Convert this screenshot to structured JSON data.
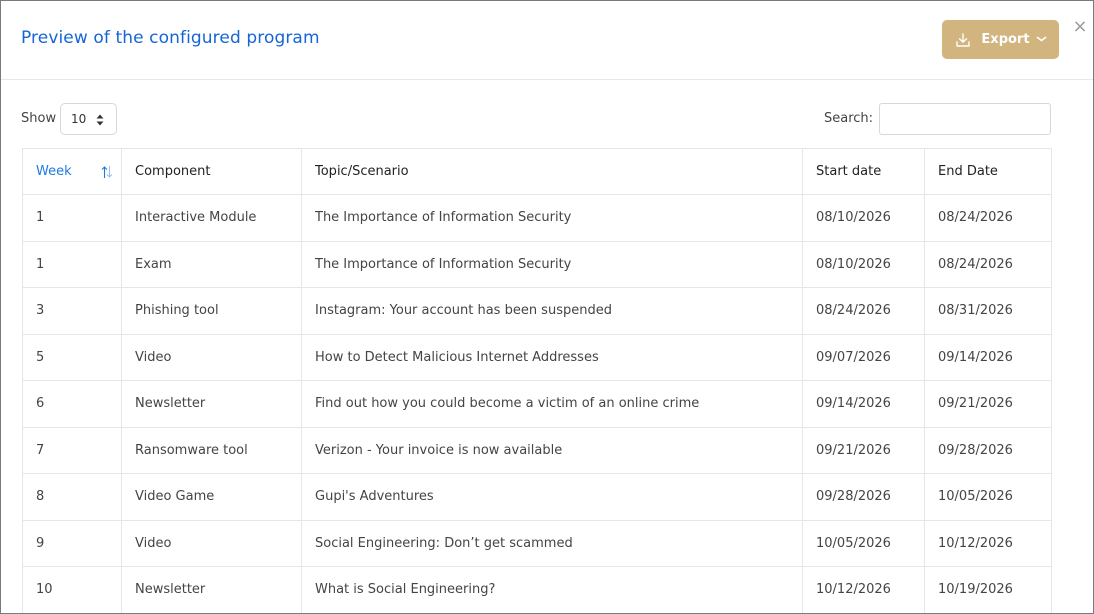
{
  "modal": {
    "title": "Preview of the configured program",
    "export_label": "Export",
    "close_symbol": "×"
  },
  "controls": {
    "show_label": "Show",
    "show_value": "10",
    "search_label": "Search:",
    "search_value": "",
    "search_placeholder": ""
  },
  "icons": {
    "export": "download-icon",
    "export_menu": "chevron-down-icon",
    "close": "close-icon",
    "sort": "sort-arrows-icon",
    "select": "select-arrows-icon"
  },
  "colors": {
    "title": "#1565d8",
    "export_button": "#d2b47f",
    "sorted_header": "#1e7be0"
  },
  "table": {
    "columns": [
      "Week",
      "Component",
      "Topic/Scenario",
      "Start date",
      "End Date"
    ],
    "rows": [
      [
        "1",
        "Interactive Module",
        "The Importance of Information Security",
        "08/10/2026",
        "08/24/2026"
      ],
      [
        "1",
        "Exam",
        "The Importance of Information Security",
        "08/10/2026",
        "08/24/2026"
      ],
      [
        "3",
        "Phishing tool",
        "Instagram: Your account has been suspended",
        "08/24/2026",
        "08/31/2026"
      ],
      [
        "5",
        "Video",
        "How to Detect Malicious Internet Addresses",
        "09/07/2026",
        "09/14/2026"
      ],
      [
        "6",
        "Newsletter",
        "Find out how you could become a victim of an online crime",
        "09/14/2026",
        "09/21/2026"
      ],
      [
        "7",
        "Ransomware tool",
        "Verizon - Your invoice is now available",
        "09/21/2026",
        "09/28/2026"
      ],
      [
        "8",
        "Video Game",
        "Gupi's Adventures",
        "09/28/2026",
        "10/05/2026"
      ],
      [
        "9",
        "Video",
        "Social Engineering: Don’t get scammed",
        "10/05/2026",
        "10/12/2026"
      ],
      [
        "10",
        "Newsletter",
        "What is Social Engineering?",
        "10/12/2026",
        "10/19/2026"
      ]
    ]
  }
}
